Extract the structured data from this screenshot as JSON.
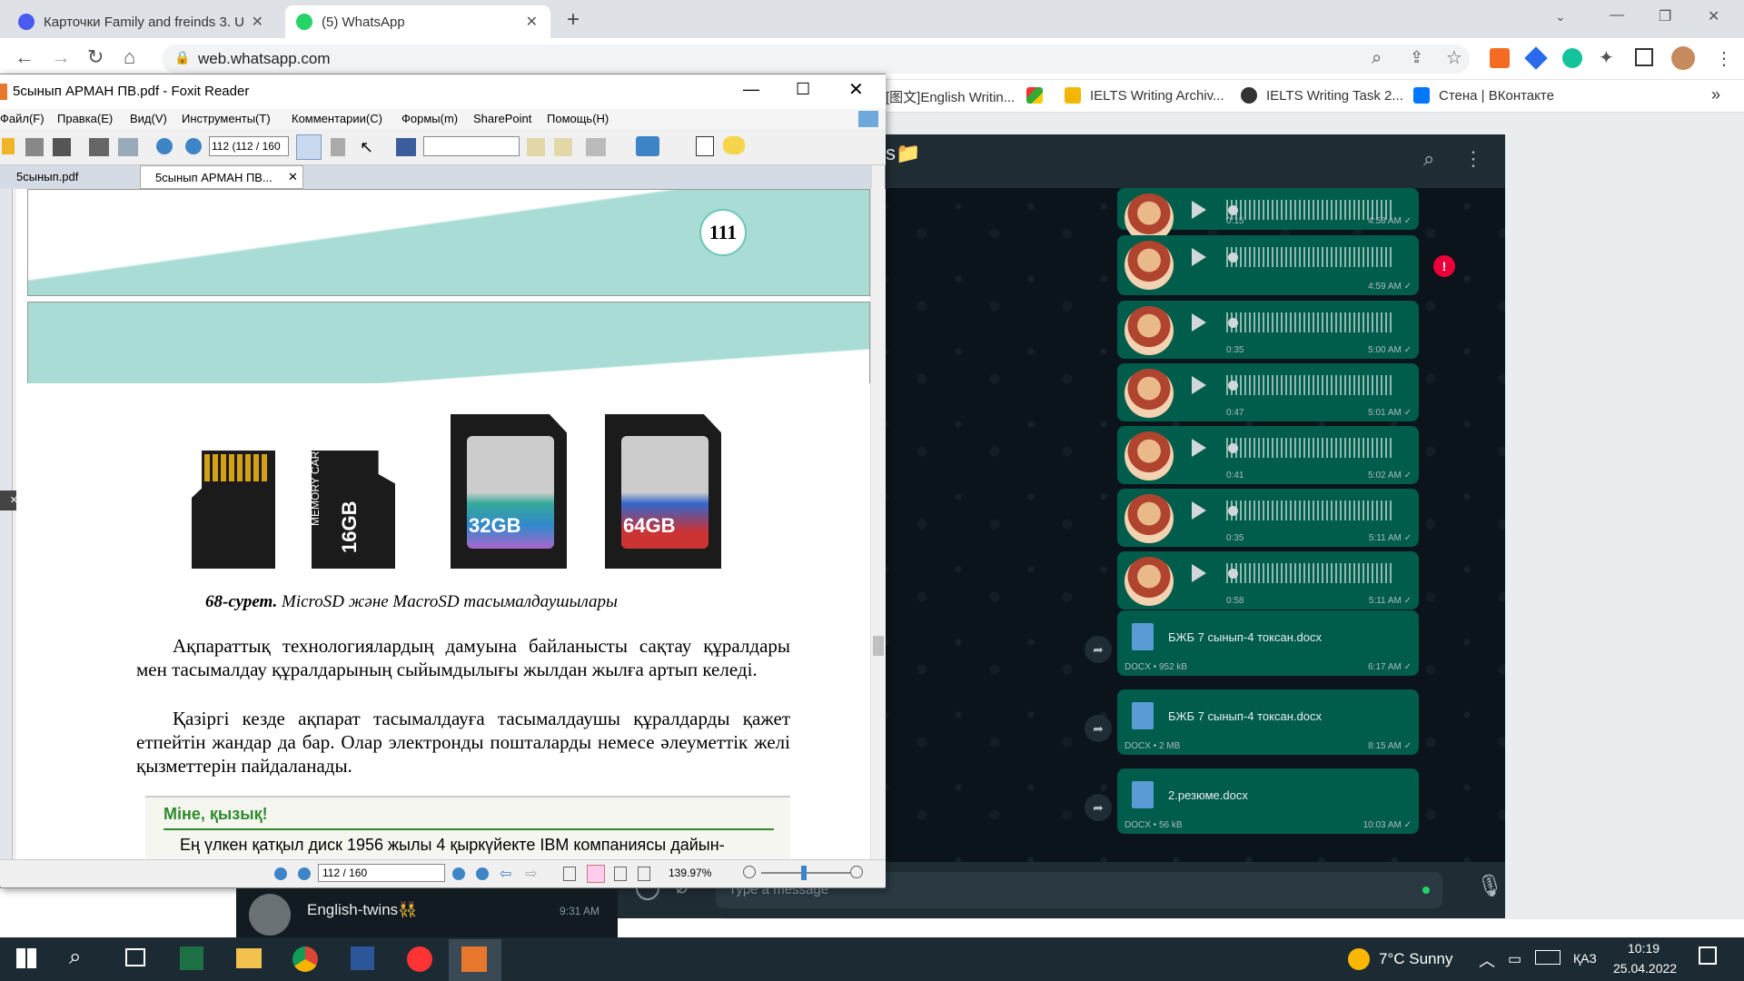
{
  "browser": {
    "tabs": [
      {
        "title": "Карточки Family and freinds 3. U",
        "active": false
      },
      {
        "title": "(5) WhatsApp",
        "active": true,
        "badge": "5"
      }
    ],
    "new_tab": "+",
    "url": "web.whatsapp.com",
    "bookmarks": [
      "[图文]English Writin...",
      "IELTS Writing Archiv...",
      "IELTS Writing Task 2...",
      "Стена | ВКонтакте"
    ],
    "more": "»"
  },
  "foxit": {
    "title": "5сынып АРМАН ПВ.pdf - Foxit Reader",
    "menu": [
      "Файл(F)",
      "Правка(E)",
      "Вид(V)",
      "Инструменты(T)",
      "Комментарии(C)",
      "Формы(m)",
      "SharePoint",
      "Помощь(H)"
    ],
    "page_field": "112 (112 / 160",
    "tabs": [
      "5сынып.pdf",
      "5сынып АРМАН ПВ..."
    ],
    "page": {
      "page_num": "111",
      "cards": [
        "16GB",
        "32GB",
        "64GB"
      ],
      "card_text": "MEMORY CARD",
      "caption_bold": "68-сурет.",
      "caption": " MicroSD және MacroSD тасымалдаушылары",
      "para1": "Ақпараттық технологиялардың дамуына байланысты сақтау құралдары мен тасымалдау құралдарының сыйымдылығы жылдан жылға артып келеді.",
      "para2": "Қазіргі кезде ақпарат тасымалдауға тасымалдаушы құралдарды қажет етпейтін жандар да бар. Олар электронды пошталарды немесе әлеуметтік желі қызметтерін пайдаланады.",
      "box_title": "Міне, қызық!",
      "box_text": "Ең үлкен қатқыл диск 1956 жылы 4 қыркүйекте IBM компаниясы дайын-"
    },
    "status_page": "112 / 160",
    "zoom": "139.97%"
  },
  "whatsapp": {
    "messages": [
      {
        "type": "voice",
        "dur": "0:15",
        "time": "4:58 AM"
      },
      {
        "type": "voice",
        "dur": "",
        "time": "4:59 AM",
        "error": "!"
      },
      {
        "type": "voice",
        "dur": "0:35",
        "time": "5:00 AM"
      },
      {
        "type": "voice",
        "dur": "0:47",
        "time": "5:01 AM"
      },
      {
        "type": "voice",
        "dur": "0:41",
        "time": "5:02 AM"
      },
      {
        "type": "voice",
        "dur": "0:35",
        "time": "5:11 AM"
      },
      {
        "type": "voice",
        "dur": "0:58",
        "time": "5:11 AM"
      },
      {
        "type": "doc",
        "name": "БЖБ 7 сынып-4 токсан.docx",
        "meta": "DOCX • 952 kB",
        "time": "6:17 AM"
      },
      {
        "type": "doc",
        "name": "БЖБ 7 сынып-4 токсан.docx",
        "meta": "DOCX • 2 MB",
        "time": "8:15 AM"
      },
      {
        "type": "doc",
        "name": "2.резюме.docx",
        "meta": "DOCX • 56 kB",
        "time": "10:03 AM"
      }
    ],
    "input_placeholder": "Type a message",
    "chat_item": {
      "name": "English-twins",
      "emoji": "👯",
      "time": "9:31 AM"
    }
  },
  "taskbar": {
    "weather": "7°C  Sunny",
    "lang": "ҚАЗ",
    "time": "10:19",
    "date": "25.04.2022"
  },
  "colors": {
    "wa_green": "#005c4b",
    "wa_dark": "#0b141a",
    "teal_band": "#a8dcd5"
  }
}
